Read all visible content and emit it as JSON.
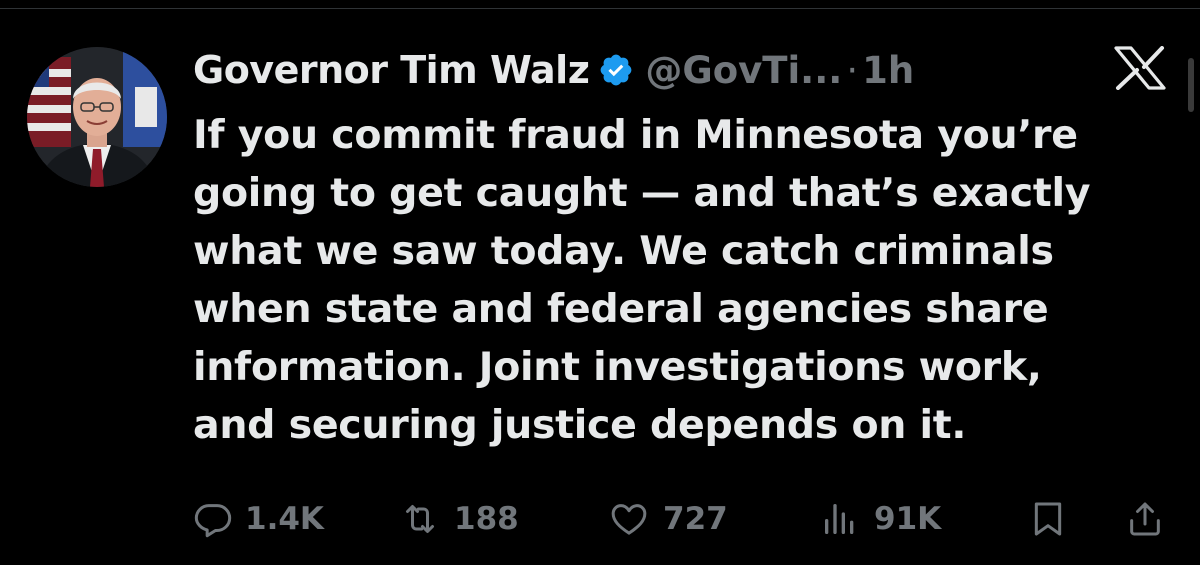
{
  "tweet": {
    "author": {
      "display_name": "Governor Tim Walz",
      "handle": "@GovTi...",
      "verified": true,
      "verified_color": "#1d9bf0"
    },
    "separator": "·",
    "time": "1h",
    "text_lines": [
      "If you commit fraud in Minnesota you’re",
      "going to get caught — and that’s exactly",
      "what we saw today. We catch criminals",
      "when state and federal agencies share",
      "information. Joint investigations work,",
      "and securing justice depends on it."
    ],
    "actions": {
      "replies": "1.4K",
      "reposts": "188",
      "likes": "727",
      "views": "91K"
    }
  },
  "icons": [
    "x-logo-icon",
    "verified-badge-icon",
    "reply-icon",
    "repost-icon",
    "like-icon",
    "views-icon",
    "bookmark-icon",
    "share-icon"
  ],
  "colors": {
    "background": "#000000",
    "text": "#e7e9ea",
    "secondary": "#71767b"
  }
}
